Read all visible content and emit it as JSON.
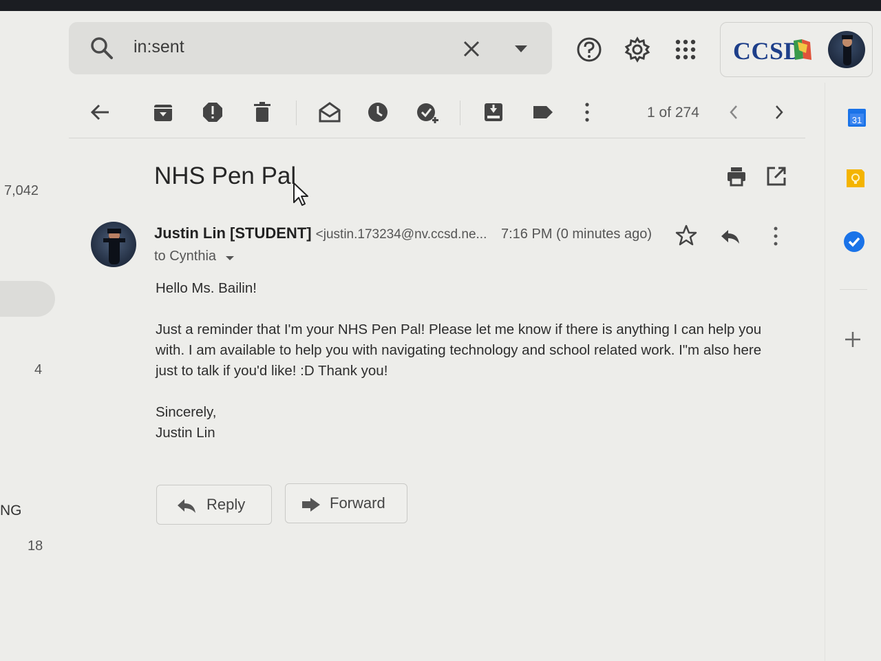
{
  "search": {
    "query": "in:sent"
  },
  "header": {
    "org_logo_text": "CCSD"
  },
  "toolbar": {
    "pager": "1 of 274"
  },
  "left_rail": {
    "counts": [
      "7,042",
      "4",
      "NG",
      "18"
    ]
  },
  "side_panel": {
    "calendar_day": "31"
  },
  "message": {
    "subject": "NHS Pen Pal",
    "sender_name": "Justin Lin [STUDENT]",
    "sender_email": "<justin.173234@nv.ccsd.ne...",
    "time": "7:16 PM (0 minutes ago)",
    "recipient": "to Cynthia",
    "greeting": "Hello Ms. Bailin!",
    "body": "Just a reminder that I'm your NHS Pen Pal! Please let me know if there is anything I can help you with. I am available to help you with navigating technology and school related work. I\"m also here just to talk if you'd like! :D Thank you!",
    "closing": "Sincerely,",
    "signature": "Justin Lin"
  },
  "actions": {
    "reply_label": "Reply",
    "forward_label": "Forward"
  },
  "colors": {
    "accent_blue": "#1a73e8",
    "ccsd_blue": "#1e3f8a",
    "keep_yellow": "#f4b400",
    "background": "#ededea"
  },
  "icons": [
    "search-icon",
    "clear-search-icon",
    "search-options-icon",
    "help-icon",
    "settings-icon",
    "apps-icon",
    "back-arrow-icon",
    "archive-icon",
    "report-spam-icon",
    "delete-icon",
    "mark-unread-icon",
    "snooze-icon",
    "add-to-tasks-icon",
    "move-to-icon",
    "label-icon",
    "more-icon",
    "prev-icon",
    "next-icon",
    "print-icon",
    "open-new-window-icon",
    "star-icon",
    "reply-icon",
    "calendar-icon",
    "keep-icon",
    "tasks-icon",
    "add-icon"
  ]
}
